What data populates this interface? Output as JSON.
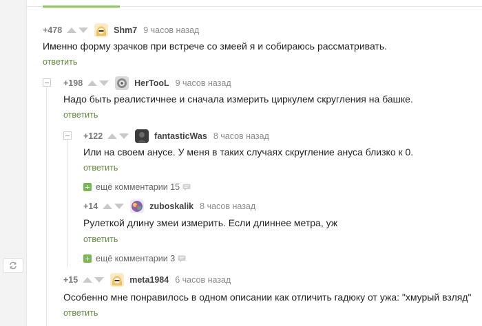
{
  "reply_label": "ответить",
  "comments": [
    {
      "rating": "+478",
      "username": "Shm7",
      "time": "9 часов назад",
      "text": "Именно форму зрачков при встрече со змеей я и собираюсь рассматривать.",
      "avatar_icon": "blonde-avatar"
    },
    {
      "rating": "+198",
      "username": "HerTooL",
      "time": "9 часов назад",
      "text": "Надо быть реалистичнее и сначала измерить циркулем скругления на башке.",
      "avatar_icon": "ornament-avatar"
    },
    {
      "rating": "+122",
      "username": "fantasticWas",
      "time": "8 часов назад",
      "text": "Или на своем анусе. У меня в таких случаях скругление ануса близко к 0.",
      "avatar_icon": "dark-photo-avatar"
    },
    {
      "rating": "+14",
      "username": "zuboskalik",
      "time": "8 часов назад",
      "text": "Рулеткой длину змеи измерить. Если длиннее метра, уж",
      "avatar_icon": "colorful-avatar"
    },
    {
      "rating": "+15",
      "username": "meta1984",
      "time": "6 часов назад",
      "text": "Особенно мне понравилось в одном описании как отличить гадюку от ужа: \"хмурый взляд\"",
      "avatar_icon": "blonde-avatar"
    }
  ],
  "more_comments": [
    {
      "label": "ещё комментарии 15"
    },
    {
      "label": "ещё комментарии 3"
    }
  ],
  "colors": {
    "reply": "#5f8a3a",
    "accent": "#8ac858",
    "plus": "#78b850"
  },
  "icons": [
    "refresh-icon",
    "vote-up-icon",
    "vote-down-icon",
    "collapse-icon",
    "expand-icon",
    "comment-bubble-icon"
  ]
}
